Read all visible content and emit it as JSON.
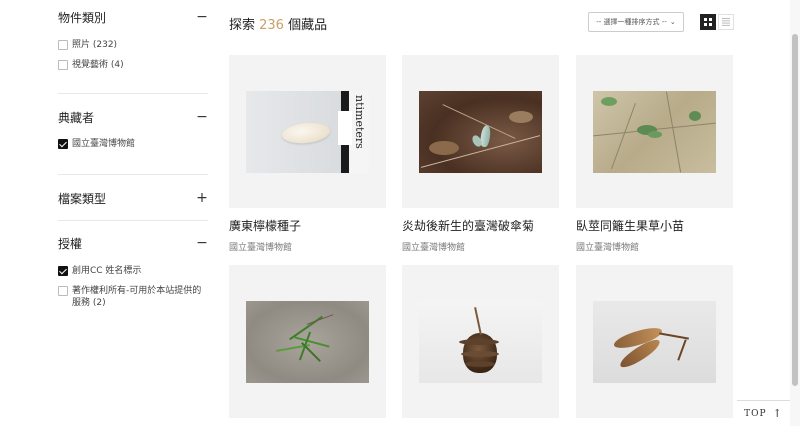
{
  "sidebar": {
    "sections": [
      {
        "title": "物件類別",
        "toggle": "−",
        "options": [
          {
            "label": "照片 (232)",
            "checked": false
          },
          {
            "label": "視覺藝術 (4)",
            "checked": false
          }
        ]
      },
      {
        "title": "典藏者",
        "toggle": "−",
        "options": [
          {
            "label": "國立臺灣博物館",
            "checked": true
          }
        ]
      },
      {
        "title": "檔案類型",
        "toggle": "+",
        "options": []
      },
      {
        "title": "授權",
        "toggle": "−",
        "options": [
          {
            "label": "創用CC 姓名標示",
            "checked": true
          },
          {
            "label": "著作權利所有-可用於本站提供的服務 (2)",
            "checked": false
          }
        ]
      }
    ]
  },
  "main": {
    "title_prefix": "探索 ",
    "count": "236",
    "title_suffix": " 個藏品",
    "sort_placeholder": "-- 選擇一種排序方式 --",
    "view_modes": [
      "grid-icon",
      "list-icon"
    ]
  },
  "cards": [
    {
      "title": "廣東檸檬種子",
      "owner": "國立臺灣博物館",
      "image": "seed-on-ruler"
    },
    {
      "title": "炎劫後新生的臺灣破傘菊",
      "owner": "國立臺灣博物館",
      "image": "sprout-in-soil"
    },
    {
      "title": "臥莖同籬生果草小苗",
      "owner": "國立臺灣博物館",
      "image": "seedlings-on-dry-ground"
    },
    {
      "title": "",
      "owner": "",
      "image": "grass-on-sand"
    },
    {
      "title": "",
      "owner": "",
      "image": "pine-cone"
    },
    {
      "title": "",
      "owner": "",
      "image": "winged-seed"
    }
  ],
  "footer": {
    "top_label": "TOP"
  },
  "colors": {
    "accent": "#c9a063",
    "card_bg": "#f3f3f3"
  }
}
